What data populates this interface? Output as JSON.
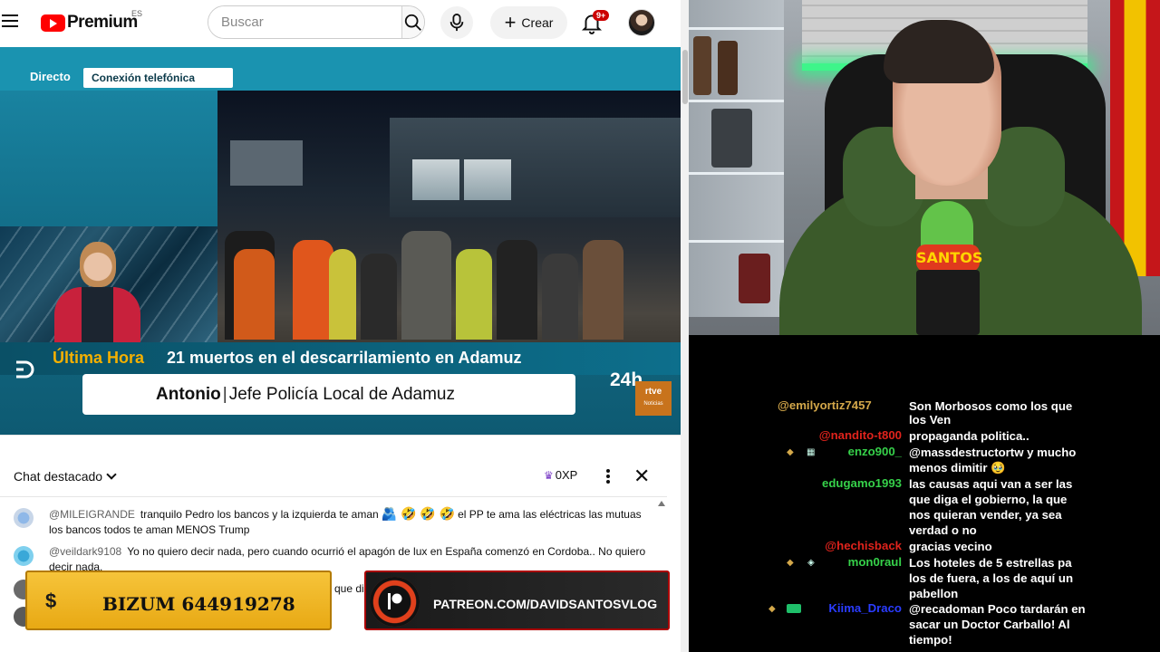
{
  "youtube": {
    "logo_text": "Premium",
    "country": "ES",
    "search_placeholder": "Buscar",
    "create_label": "Crear",
    "notifications": "9+"
  },
  "video": {
    "live_tag": "Directo",
    "segment_tag": "Conexión telefónica",
    "breaking_label": "Última Hora",
    "headline": "21 muertos en el descarrilamiento en Adamuz",
    "speaker_name": "Antonio",
    "speaker_role": "Jefe Policía Local de Adamuz",
    "channel_24h": "24h",
    "rtve_logo": "rtve",
    "rtve_sub": "Noticias"
  },
  "chat": {
    "title": "Chat destacado",
    "xp": "0XP",
    "messages": [
      {
        "author": "@MILEIGRANDE",
        "text_a": "tranquilo Pedro los bancos y la izquierda te aman",
        "emojis": "🫂 🤣 🤣 🤣",
        "text_b": "el PP te ama las eléctricas las mutuas los bancos todos te aman MENOS Trump"
      },
      {
        "author": "@veildark9108",
        "text": "Yo no quiero decir nada, pero cuando ocurrió el apagón de lux en España comenzó en Cordoba.. No quiero decir nada."
      }
    ],
    "hidden_tail": "que di",
    "bizum_symbol": "$",
    "bizum": "BIZUM 644919278",
    "patreon": "PATREON.COM/DAVIDSANTOSVLOG"
  },
  "stream": {
    "mic_brand": "SANTOS"
  },
  "overlay_chat": {
    "colors": {
      "red": "#e0231c",
      "green": "#36d14a",
      "blue": "#2a3cff",
      "gold": "#d4a84a"
    },
    "rows": [
      {
        "name": "@emilyortiz7457",
        "text": "Son Morbosos como los que"
      },
      {
        "name": "",
        "text": "los Ven"
      },
      {
        "name": "@nandito-t800",
        "text": "propaganda politica.."
      },
      {
        "name": "enzo900_",
        "text": "@massdestructortw y mucho"
      },
      {
        "name": "",
        "text": "menos dimitir 🥹"
      },
      {
        "name": "edugamo1993",
        "text": "las causas aqui van a ser las"
      },
      {
        "name": "",
        "text": "que diga el gobierno, la que"
      },
      {
        "name": "",
        "text": "nos quieran vender, ya sea"
      },
      {
        "name": "",
        "text": "verdad o no"
      },
      {
        "name": "@hechisback",
        "text": "gracias vecino"
      },
      {
        "name": "mon0raul",
        "text": "Los hoteles de 5 estrellas pa"
      },
      {
        "name": "",
        "text": "los de fuera, a los de aquí un"
      },
      {
        "name": "",
        "text": "pabellon"
      },
      {
        "name": "Kiima_Draco",
        "text": "@recadoman Poco tardarán en"
      },
      {
        "name": "",
        "text": "sacar un Doctor Carballo! Al"
      },
      {
        "name": "",
        "text": "tiempo!"
      }
    ]
  }
}
